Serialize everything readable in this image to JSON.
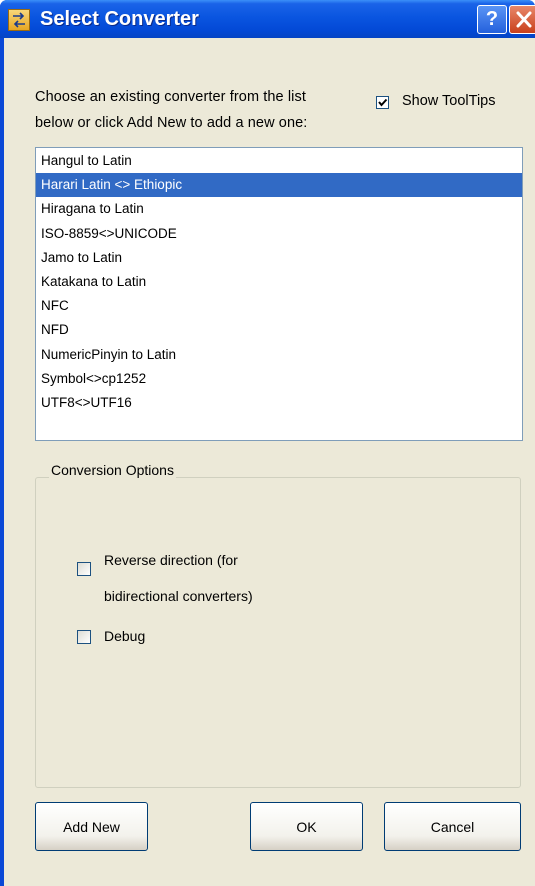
{
  "window": {
    "title": "Select Converter",
    "help_glyph": "?",
    "close_icon": "close-icon",
    "app_icon": "converter-app-icon"
  },
  "prompt": {
    "line1": "Choose an existing converter from the list",
    "line2": "below or click Add New to add a new one:"
  },
  "show_tooltips": {
    "label": "Show ToolTips",
    "checked": true
  },
  "converters": {
    "items": [
      "Hangul to Latin",
      "Harari Latin <> Ethiopic",
      "Hiragana to Latin",
      "ISO-8859<>UNICODE",
      "Jamo to Latin",
      "Katakana to Latin",
      "NFC",
      "NFD",
      "NumericPinyin to Latin",
      "Symbol<>cp1252",
      "UTF8<>UTF16"
    ],
    "selected_index": 1
  },
  "conversion_options": {
    "title": "Conversion Options",
    "reverse_line1": "Reverse direction (for",
    "reverse_line2": "bidirectional converters)",
    "reverse_checked": false,
    "debug": "Debug",
    "debug_checked": false
  },
  "buttons": {
    "add_new": "Add New",
    "ok": "OK",
    "cancel": "Cancel"
  },
  "colors": {
    "titlebar": "#0a55e0",
    "selection": "#316ac5",
    "dialog_bg": "#ece9d8",
    "close_button": "#c9401c"
  }
}
